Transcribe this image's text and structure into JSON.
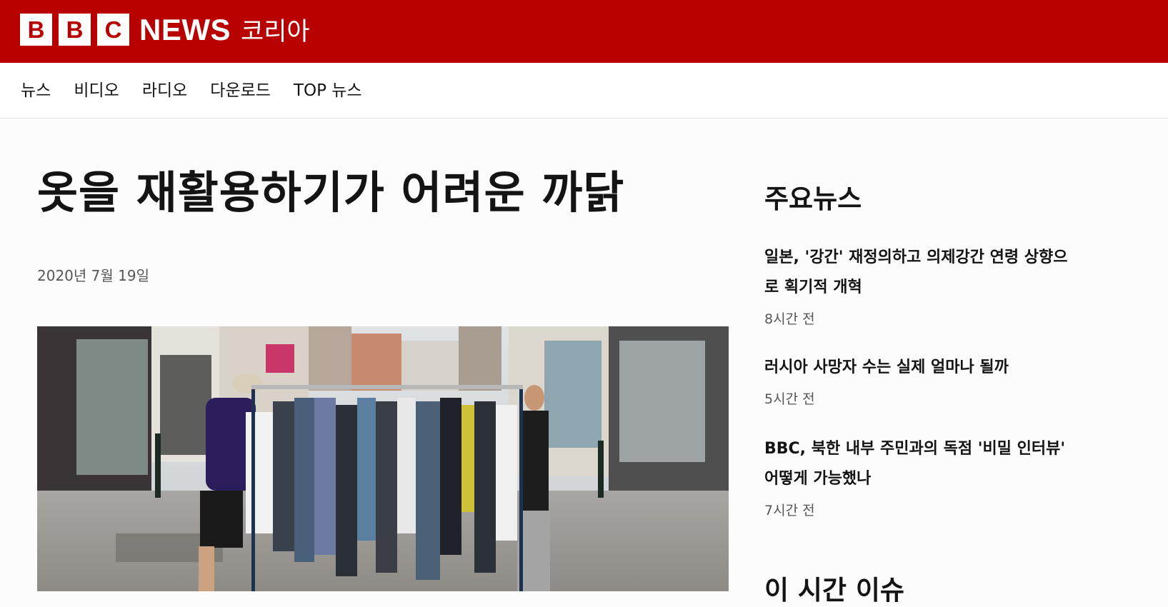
{
  "header": {
    "brand_letters": [
      "B",
      "B",
      "C"
    ],
    "brand_news": "NEWS",
    "service_name": "코리아",
    "bg_color": "#b80000"
  },
  "nav": {
    "items": [
      {
        "label": "뉴스"
      },
      {
        "label": "비디오"
      },
      {
        "label": "라디오"
      },
      {
        "label": "다운로드"
      },
      {
        "label": "TOP 뉴스"
      }
    ]
  },
  "article": {
    "headline": "옷을 재활용하기가 어려운 까닭",
    "date": "2020년 7월 19일",
    "image_alt": "street-clothing-rack-photo"
  },
  "sidebar": {
    "top_news_title": "주요뉴스",
    "stories": [
      {
        "title": "일본, '강간' 재정의하고 의제강간 연령 상향으로 획기적 개혁",
        "time": "8시간 전"
      },
      {
        "title": "러시아 사망자 수는 실제 얼마나 될까",
        "time": "5시간 전"
      },
      {
        "title": "BBC, 북한 내부 주민과의 독점 '비밀 인터뷰' 어떻게 가능했나",
        "time": "7시간 전"
      }
    ],
    "second_section_title": "이 시간 이슈"
  }
}
